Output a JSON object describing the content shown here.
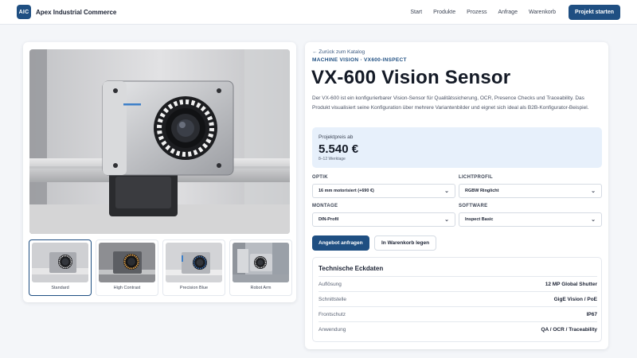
{
  "header": {
    "logo_text": "AIC",
    "brand": "Apex Industrial Commerce",
    "nav": [
      "Start",
      "Produkte",
      "Prozess",
      "Anfrage",
      "Warenkorb"
    ],
    "cta_label": "Projekt starten"
  },
  "gallery": {
    "thumbnails": [
      {
        "label": "Standard",
        "active": true
      },
      {
        "label": "High Contrast",
        "active": false
      },
      {
        "label": "Precision Blue",
        "active": false
      },
      {
        "label": "Robot Arm",
        "active": false
      }
    ]
  },
  "product": {
    "back_link": "← Zurück zum Katalog",
    "eyebrow": "MACHINE VISION · VX600-INSPECT",
    "title": "VX-600 Vision Sensor",
    "description": "Der VX-600 ist ein konfigurierbarer Vision-Sensor für Qualitätssicherung, OCR, Presence Checks und Traceability. Das Produkt visualisiert seine Konfiguration über mehrere Variantenbilder und eignet sich ideal als B2B-Konfigurator-Beispiel.",
    "price_label": "Projektpreis ab",
    "price": "5.540 €",
    "delivery": "8–12 Werktage",
    "options": {
      "optik_label": "OPTIK",
      "optik_value": "16 mm motorisiert (+690 €)",
      "licht_label": "LICHTPROFIL",
      "licht_value": "RGBW Ringlicht",
      "montage_label": "MONTAGE",
      "montage_value": "DIN-Profil",
      "software_label": "SOFTWARE",
      "software_value": "Inspect Basic"
    },
    "request_button": "Angebot anfragen",
    "cart_button": "In Warenkorb legen",
    "specs": {
      "title": "Technische Eckdaten",
      "rows": [
        {
          "key": "Auflösung",
          "value": "12 MP Global Shutter"
        },
        {
          "key": "Schnittstelle",
          "value": "GigE Vision / PoE"
        },
        {
          "key": "Frontschutz",
          "value": "IP67"
        },
        {
          "key": "Anwendung",
          "value": "QA / OCR / Traceability"
        }
      ]
    }
  },
  "colors": {
    "accent": "#1f4f82",
    "price_bg": "#e7f0fb",
    "page_bg": "#f4f6f9"
  }
}
